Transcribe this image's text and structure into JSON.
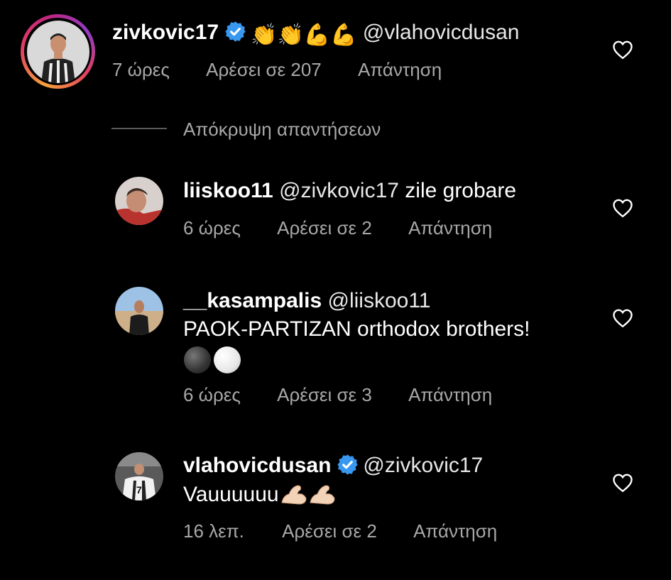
{
  "comments": [
    {
      "username": "zivkovic17",
      "verified": true,
      "emoji_text": "👏👏💪💪",
      "mention": "@vlahovicdusan",
      "time": "7 ώρες",
      "likes": "Αρέσει σε 207",
      "reply": "Απάντηση"
    },
    {
      "username": "liiskoo11",
      "mention": "@zivkovic17",
      "text": "zile grobare",
      "time": "6 ώρες",
      "likes": "Αρέσει σε 2",
      "reply": "Απάντηση"
    },
    {
      "username": "__kasampalis",
      "mention": "@liiskoo11",
      "text": "PAOK-PARTIZAN orthodox brothers!",
      "time": "6 ώρες",
      "likes": "Αρέσει σε 3",
      "reply": "Απάντηση"
    },
    {
      "username": "vlahovicdusan",
      "verified": true,
      "mention": "@zivkovic17",
      "text": "Vauuuuuu",
      "time": "16 λεπ.",
      "likes": "Αρέσει σε 2",
      "reply": "Απάντηση"
    }
  ],
  "hide_replies": "Απόκρυψη απαντήσεων",
  "colors": {
    "background": "#000000",
    "meta": "#a8a8a8",
    "verified": "#3897f0"
  },
  "icons": [
    "heart-outline-icon",
    "verified-badge-icon"
  ]
}
